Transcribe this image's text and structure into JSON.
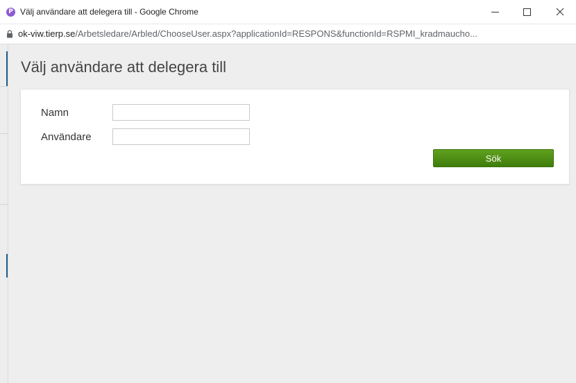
{
  "window": {
    "favicon_letter": "P",
    "title": "Välj användare att delegera till - Google Chrome"
  },
  "address_bar": {
    "host": "ok-viw.tierp.se",
    "path": "/Arbetsledare/Arbled/ChooseUser.aspx?applicationId=RESPONS&functionId=RSPMI_kradmaucho..."
  },
  "page": {
    "title": "Välj användare att delegera till"
  },
  "form": {
    "name_label": "Namn",
    "name_value": "",
    "user_label": "Användare",
    "user_value": "",
    "search_label": "Sök"
  },
  "colors": {
    "accent": "#1f5f8b",
    "button": "#4e8f16",
    "favicon": "#8e5bd1"
  }
}
